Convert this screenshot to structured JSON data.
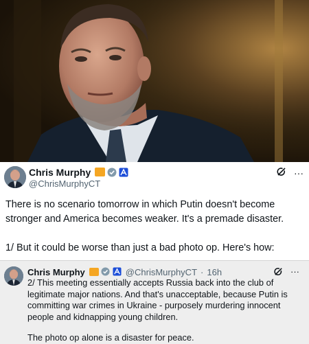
{
  "main_tweet": {
    "author_name": "Chris Murphy",
    "handle": "@ChrisMurphyCT",
    "paragraph_1": "There is no scenario tomorrow in which Putin doesn't become stronger and America becomes weaker. It's a premade disaster.",
    "paragraph_2": "1/ But it could be worse than just a bad photo op. Here's how:",
    "icons": {
      "grok": "grok-icon",
      "more": "more-options-icon"
    },
    "more_glyph": "···"
  },
  "quoted_tweet": {
    "author_name": "Chris Murphy",
    "handle": "@ChrisMurphyCT",
    "separator": "·",
    "time": "16h",
    "paragraph_1": "2/ This meeting essentially accepts Russia back into the club of legitimate major nations. And that's unacceptable, because Putin is committing war crimes in Ukraine - purposely murdering innocent people and kidnapping young children.",
    "paragraph_2": "The photo op alone is a disaster for peace.",
    "more_glyph": "···"
  },
  "colors": {
    "badge_gold": "#f5a623",
    "verified_gray": "#829aab",
    "gov_blue": "#1d4ed8",
    "handle_gray": "#536471",
    "quote_bg": "#eeeeee"
  }
}
